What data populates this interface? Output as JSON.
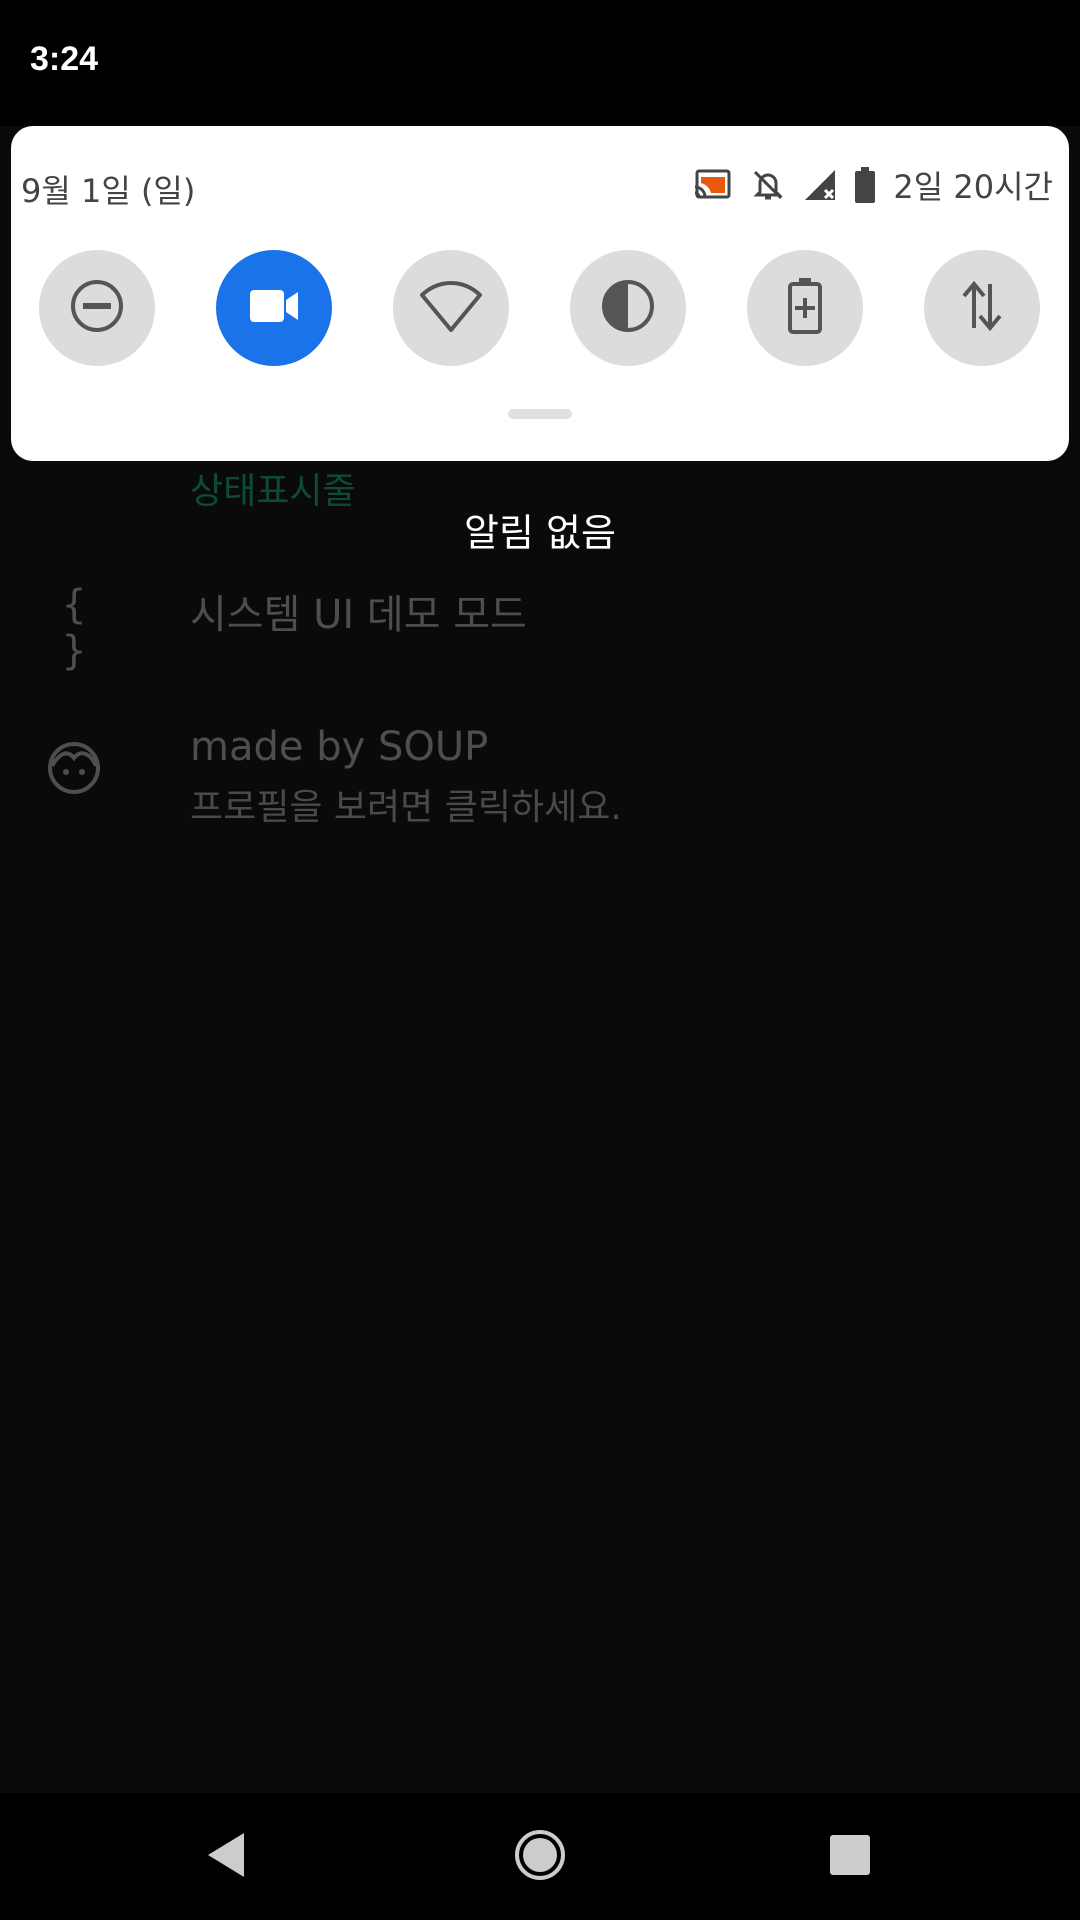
{
  "status_bar": {
    "time": "3:24"
  },
  "quick_settings": {
    "date": "9월 1일 (일)",
    "battery_remaining": "2일 20시간",
    "status_icons": [
      "cast-icon",
      "bell-off-icon",
      "no-signal-icon",
      "battery-icon"
    ],
    "tiles": [
      {
        "name": "dnd-tile",
        "icon": "do-not-disturb-icon",
        "active": false
      },
      {
        "name": "screen-record-tile",
        "icon": "video-camera-icon",
        "active": true
      },
      {
        "name": "wifi-tile",
        "icon": "wifi-icon",
        "active": false
      },
      {
        "name": "invert-colors-tile",
        "icon": "invert-colors-icon",
        "active": false
      },
      {
        "name": "battery-saver-tile",
        "icon": "battery-saver-icon",
        "active": false
      },
      {
        "name": "mobile-data-tile",
        "icon": "data-arrows-icon",
        "active": false
      }
    ],
    "active_color": "#1a73e8",
    "tile_color": "#dcdcdc"
  },
  "notifications": {
    "empty_text": "알림 없음"
  },
  "settings_list": {
    "category_title": "상태표시줄",
    "category_color": "#0d4a3a",
    "items": [
      {
        "icon": "braces-icon",
        "icon_text": "{ }",
        "title": "시스템 UI 데모 모드"
      },
      {
        "icon": "face-icon",
        "title": "made by SOUP",
        "subtitle": "프로필을 보려면 클릭하세요."
      }
    ]
  },
  "nav_bar": {
    "buttons": [
      "back-button",
      "home-button",
      "recents-button"
    ]
  }
}
